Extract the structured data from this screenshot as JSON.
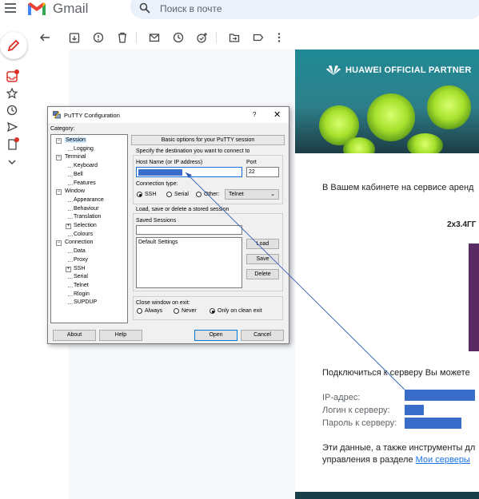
{
  "gmail": {
    "app_name": "Gmail",
    "search_placeholder": "Поиск в почте",
    "colors": {
      "red": "#d93025",
      "logo_blue": "#4285f4",
      "logo_green": "#34a853",
      "logo_yellow": "#fbbc04"
    }
  },
  "email": {
    "banner_text": "HUAWEI OFFICIAL PARTNER",
    "para1": "В Вашем кабинете на сервисе аренд",
    "config_title": "2x3.4ГГ",
    "connect_text": "Подключиться к серверу Вы можете",
    "ip_label": "IP-адрес:",
    "login_label": "Логин к серверу:",
    "password_label": "Пароль к серверу:",
    "footer_line1": "Эти данные, а также инструменты дл",
    "footer_line2_prefix": "управления в разделе ",
    "footer_link": "Мои серверы",
    "redaction_color": "#3a6dc9"
  },
  "putty": {
    "title": "PuTTY Configuration",
    "help_label": "?",
    "close_label": "✕",
    "category_label": "Category:",
    "tree": [
      {
        "label": "Session",
        "level": 0,
        "expander": "⊟"
      },
      {
        "label": "Logging",
        "level": 1
      },
      {
        "label": "Terminal",
        "level": 0,
        "expander": "⊟"
      },
      {
        "label": "Keyboard",
        "level": 1
      },
      {
        "label": "Bell",
        "level": 1
      },
      {
        "label": "Features",
        "level": 1
      },
      {
        "label": "Window",
        "level": 0,
        "expander": "⊟"
      },
      {
        "label": "Appearance",
        "level": 1
      },
      {
        "label": "Behaviour",
        "level": 1
      },
      {
        "label": "Translation",
        "level": 1
      },
      {
        "label": "Selection",
        "level": 1,
        "expander": "⊞"
      },
      {
        "label": "Colours",
        "level": 1
      },
      {
        "label": "Connection",
        "level": 0,
        "expander": "⊟"
      },
      {
        "label": "Data",
        "level": 1
      },
      {
        "label": "Proxy",
        "level": 1
      },
      {
        "label": "SSH",
        "level": 1,
        "expander": "⊞"
      },
      {
        "label": "Serial",
        "level": 1
      },
      {
        "label": "Telnet",
        "level": 1
      },
      {
        "label": "Rlogin",
        "level": 1
      },
      {
        "label": "SUPDUP",
        "level": 1
      }
    ],
    "panel_title": "Basic options for your PuTTY session",
    "dest_label": "Specify the destination you want to connect to",
    "host_label": "Host Name (or IP address)",
    "port_label": "Port",
    "port_value": "22",
    "conn_type_label": "Connection type:",
    "conn_types": [
      "SSH",
      "Serial",
      "Other:"
    ],
    "conn_selected": "SSH",
    "other_select": "Telnet",
    "sessions_group_label": "Load, save or delete a stored session",
    "saved_sessions_label": "Saved Sessions",
    "sessions": [
      "Default Settings"
    ],
    "load_label": "Load",
    "save_label": "Save",
    "delete_label": "Delete",
    "close_exit_label": "Close window on exit:",
    "close_options": [
      "Always",
      "Never",
      "Only on clean exit"
    ],
    "close_selected": "Only on clean exit",
    "about_label": "About",
    "help_button_label": "Help",
    "open_label": "Open",
    "cancel_label": "Cancel"
  }
}
